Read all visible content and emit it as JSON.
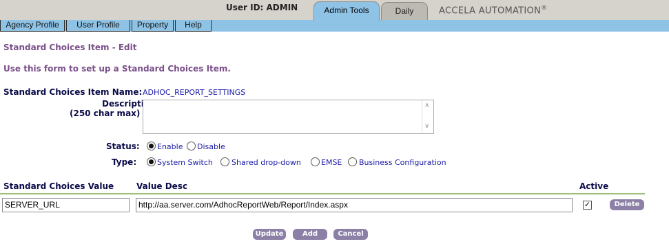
{
  "header": {
    "user_id": "User ID: ADMIN",
    "tabs": [
      {
        "label": "Admin Tools",
        "active": true
      },
      {
        "label": "Daily",
        "active": false
      }
    ],
    "brand": "ACCELA AUTOMATION",
    "brand_mark": "®"
  },
  "menu": {
    "items": [
      "Agency Profile",
      "User Profile",
      "Property",
      "Help"
    ]
  },
  "page": {
    "title": "Standard Choices Item - Edit",
    "intro": "Use this form to set up a Standard Choices Item."
  },
  "form": {
    "item_name_label": "Standard Choices Item Name:",
    "item_name_value": "ADHOC_REPORT_SETTINGS",
    "description_label": "Description:",
    "description_hint": "(250 char max)",
    "description_value": "",
    "status_label": "Status:",
    "status_options": [
      "Enable",
      "Disable"
    ],
    "status_selected": "Enable",
    "type_label": "Type:",
    "type_options": [
      "System Switch",
      "Shared drop-down",
      "EMSE",
      "Business Configuration"
    ],
    "type_selected": "System Switch"
  },
  "values_table": {
    "columns": [
      "Standard Choices Value",
      "Value Desc",
      "Active"
    ],
    "rows": [
      {
        "value": "SERVER_URL",
        "desc": "http://aa.server.com/AdhocReportWeb/Report/Index.aspx",
        "active": true,
        "delete_label": "Delete"
      }
    ]
  },
  "actions": {
    "update": "Update",
    "add": "Add",
    "cancel": "Cancel"
  },
  "colors": {
    "menu_bg": "#8ec3e6",
    "heading": "#7a4f8a",
    "button": "#8d80a6",
    "rule": "#9ec07a"
  }
}
